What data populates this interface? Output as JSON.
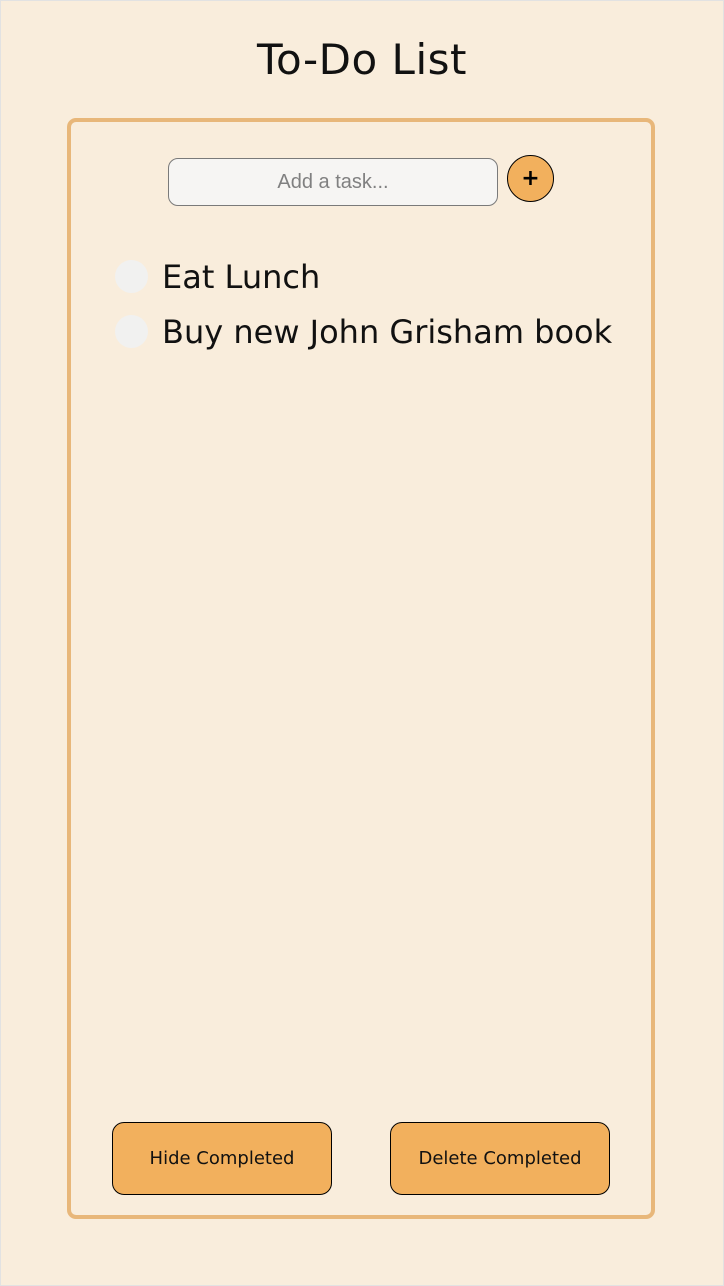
{
  "header": {
    "title": "To-Do List"
  },
  "add_task": {
    "placeholder": "Add a task...",
    "value": "",
    "button_label": "+"
  },
  "tasks": [
    {
      "label": "Eat Lunch",
      "completed": false
    },
    {
      "label": "Buy new John Grisham book",
      "completed": false
    }
  ],
  "footer": {
    "hide_completed_label": "Hide Completed",
    "delete_completed_label": "Delete Completed"
  },
  "colors": {
    "background": "#f9eddc",
    "card_border": "#e8b77a",
    "accent": "#f2b05d",
    "checkbox": "#f1f1f0"
  }
}
